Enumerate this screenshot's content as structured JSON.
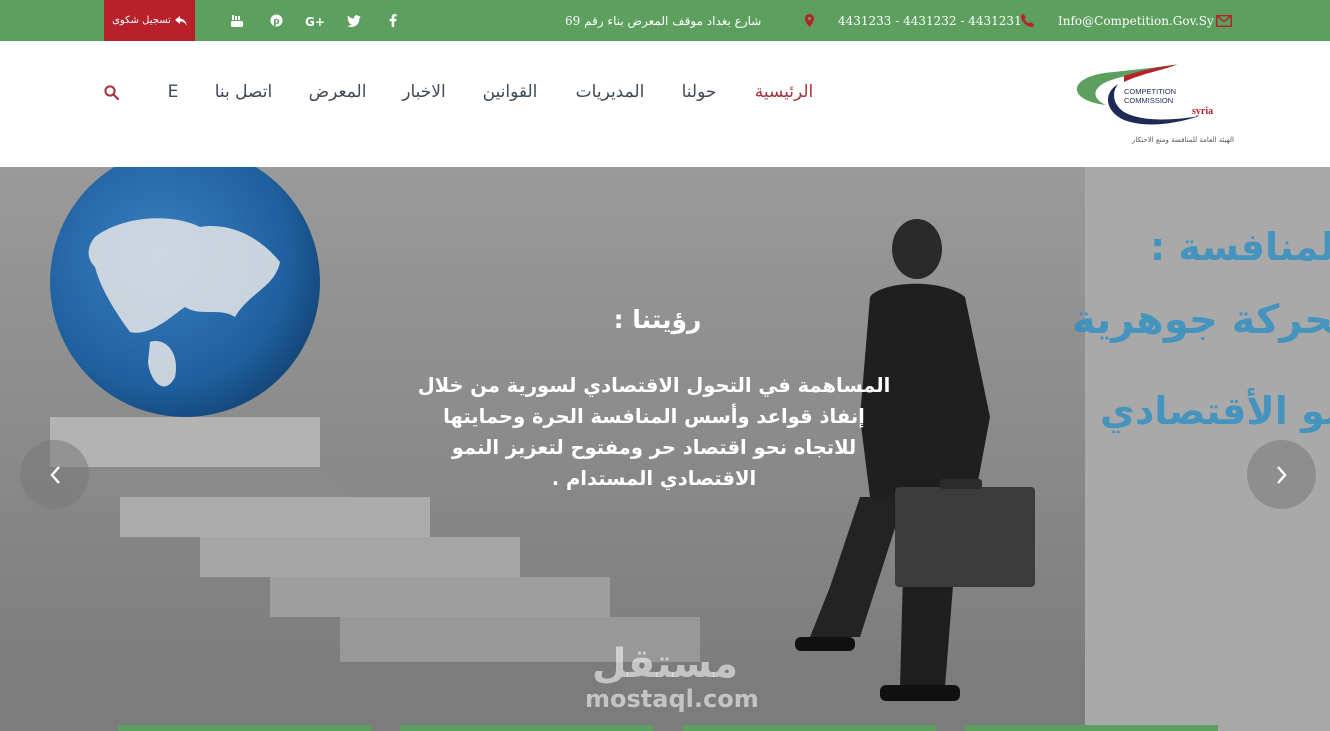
{
  "topbar": {
    "complaint_label": "تسجيل شكوى",
    "social_icons": [
      "youtube-icon",
      "pinterest-icon",
      "google-plus-icon",
      "twitter-icon",
      "facebook-icon"
    ],
    "address": "شارع بغداد موقف المعرض بناء رقم 69",
    "phones": "4431233 - 4431232 - 4431231",
    "email": "Info@Competition.Gov.Sy"
  },
  "nav": {
    "items": [
      "الرئيسية",
      "حولنا",
      "المديريات",
      "القوانين",
      "الاخبار",
      "المعرض",
      "اتصل بنا",
      "E"
    ],
    "active_index": 0
  },
  "logo": {
    "line1": "COMPETITION",
    "line2": "COMMISSION",
    "line3": "syria",
    "arabic": "الهيئة العامة للمنافسة ومنع الاحتكار"
  },
  "hero": {
    "title": "رؤيتنا :",
    "lines": [
      "المساهمة في التحول الاقتصادي لسورية من خلال",
      "إنفاذ قواعد وأسس المنافسة الحرة وحمايتها",
      "للاتجاه نحو اقتصاد حر ومفتوح لتعزيز النمو",
      "الاقتصادي المستدام ."
    ],
    "bg_text": [
      "المنافسة :",
      "ة محركة جوهرية",
      "لنمو الأقتصادي"
    ]
  },
  "watermark": {
    "arabic": "مستقل",
    "latin": "mostaql.com"
  },
  "colors": {
    "green": "#5c9f5e",
    "red": "#b8202b",
    "nav_active": "#a8323c",
    "nav": "#3e4a56"
  }
}
